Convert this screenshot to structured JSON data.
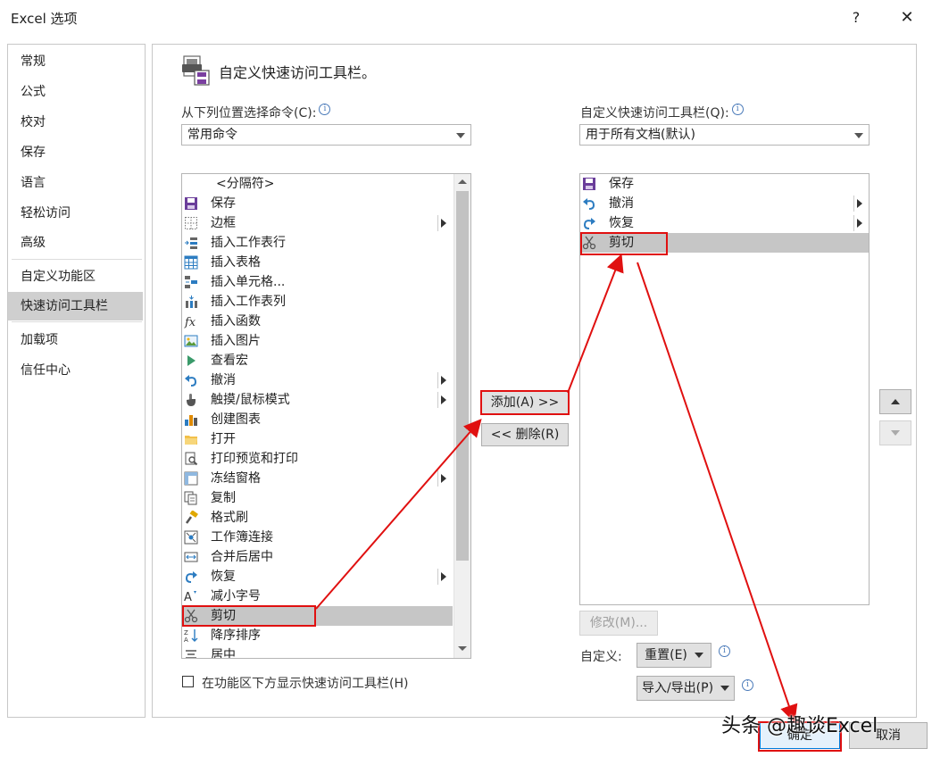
{
  "window": {
    "title": "Excel 选项",
    "help": "?",
    "close": "✕"
  },
  "nav": [
    "常规",
    "公式",
    "校对",
    "保存",
    "语言",
    "轻松访问",
    "高级",
    "自定义功能区",
    "快速访问工具栏",
    "加载项",
    "信任中心"
  ],
  "nav_selected": "快速访问工具栏",
  "section_title": "自定义快速访问工具栏。",
  "left": {
    "label": "从下列位置选择命令(C):",
    "combo_value": "常用命令",
    "items": [
      {
        "label": "<分隔符>",
        "icon": "none"
      },
      {
        "label": "保存",
        "icon": "save-icon"
      },
      {
        "label": "边框",
        "icon": "border-icon",
        "submenu": true
      },
      {
        "label": "插入工作表行",
        "icon": "insert-row-icon"
      },
      {
        "label": "插入表格",
        "icon": "table-icon"
      },
      {
        "label": "插入单元格...",
        "icon": "insert-cell-icon"
      },
      {
        "label": "插入工作表列",
        "icon": "insert-column-icon"
      },
      {
        "label": "插入函数",
        "icon": "function-icon"
      },
      {
        "label": "插入图片",
        "icon": "picture-icon"
      },
      {
        "label": "查看宏",
        "icon": "macro-icon"
      },
      {
        "label": "撤消",
        "icon": "undo-icon",
        "submenu": true
      },
      {
        "label": "触摸/鼠标模式",
        "icon": "touch-icon",
        "submenu": true
      },
      {
        "label": "创建图表",
        "icon": "chart-icon"
      },
      {
        "label": "打开",
        "icon": "folder-icon"
      },
      {
        "label": "打印预览和打印",
        "icon": "print-preview-icon"
      },
      {
        "label": "冻结窗格",
        "icon": "freeze-icon",
        "submenu": true
      },
      {
        "label": "复制",
        "icon": "copy-icon"
      },
      {
        "label": "格式刷",
        "icon": "format-painter-icon"
      },
      {
        "label": "工作簿连接",
        "icon": "connection-icon"
      },
      {
        "label": "合并后居中",
        "icon": "merge-icon"
      },
      {
        "label": "恢复",
        "icon": "redo-icon",
        "submenu": true
      },
      {
        "label": "减小字号",
        "icon": "font-decrease-icon"
      },
      {
        "label": "剪切",
        "icon": "scissors-icon",
        "selected": true
      },
      {
        "label": "降序排序",
        "icon": "sort-desc-icon"
      },
      {
        "label": "居中",
        "icon": "center-icon"
      }
    ]
  },
  "right": {
    "label": "自定义快速访问工具栏(Q):",
    "combo_value": "用于所有文档(默认)",
    "items": [
      {
        "label": "保存",
        "icon": "save-icon"
      },
      {
        "label": "撤消",
        "icon": "undo-icon",
        "submenu": true
      },
      {
        "label": "恢复",
        "icon": "redo-icon",
        "submenu": true
      },
      {
        "label": "剪切",
        "icon": "scissors-icon",
        "selected": true
      }
    ]
  },
  "buttons": {
    "add": "添加(A) >>",
    "remove": "<< 删除(R)",
    "modify": "修改(M)...",
    "customize_label": "自定义:",
    "reset": "重置(E)",
    "import_export": "导入/导出(P)",
    "ok": "确定",
    "cancel": "取消"
  },
  "checkbox_label": "在功能区下方显示快速访问工具栏(H)",
  "watermark": "头条 @趣谈Excel",
  "colors": {
    "annotation": "#e01010",
    "selected_row": "#c6c6c6",
    "nav_selected": "#cfcfcf"
  }
}
